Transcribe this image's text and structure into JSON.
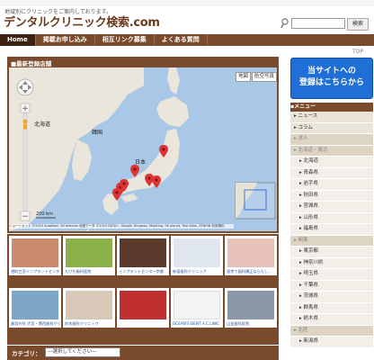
{
  "header": {
    "tagline": "地域別にクリニックをご案内しております。",
    "site_title": "デンタルクリニック検索.com",
    "search_button": "検索"
  },
  "nav": {
    "items": [
      {
        "label": "Home"
      },
      {
        "label": "掲載お申し込み"
      },
      {
        "label": "相互リンク募集"
      },
      {
        "label": "よくある質問"
      }
    ]
  },
  "top_link": "TOP",
  "map_panel": {
    "title": "■最新登録店舗",
    "map_type_map": "地図",
    "map_type_satellite": "航空写真",
    "labels": {
      "hokkaido": "北海道",
      "korea": "韓国",
      "japan": "日本"
    },
    "scale": "200 km",
    "attribution": "ショートカット ©2015 AutoNavi, SK telecom 地図データ ©2015 DATA+, Google, Kingway, MapKing, SK planet, Tele Atlas, ZENRIN 利用規約"
  },
  "thumbnails": [
    {
      "caption": "港町三宮インプラントセンター",
      "color": "#c88a6a"
    },
    {
      "caption": "たけち歯科医院",
      "color": "#8bb04a"
    },
    {
      "caption": "インプラントセンター京都",
      "color": "#5a3a2a"
    },
    {
      "caption": "新宿歯科クリニック",
      "color": "#dfe6ee"
    },
    {
      "caption": "東京で歯科矯正ならたし...",
      "color": "#e8c2b8"
    },
    {
      "caption": "美容外科 大宮・博西歯科クリニック",
      "color": "#7ea4c6"
    },
    {
      "caption": "鈴木歯科クリニック",
      "color": "#d8c8b8"
    },
    {
      "caption": "",
      "color": "#c03030"
    },
    {
      "caption": "OCEAN'S DENT A.C.LINIC",
      "color": "#f4f4f4"
    },
    {
      "caption": "山並歯科医院",
      "color": "#8c98a8"
    }
  ],
  "category": {
    "label": "カテゴリ：",
    "select_value": "—選択してください—"
  },
  "sidebar": {
    "banner_line1": "当サイトへの",
    "banner_line2": "登録はこちらから",
    "menu_title": "▪メニュー",
    "items": [
      {
        "label": "▸ ニュース",
        "type": "top"
      },
      {
        "label": "▸ コラム",
        "type": "top"
      },
      {
        "label": "▸ 求人",
        "type": "group"
      },
      {
        "label": "▸ 北海道・東北",
        "type": "group"
      },
      {
        "label": "▸ 北海道",
        "type": "sub"
      },
      {
        "label": "▸ 青森県",
        "type": "sub"
      },
      {
        "label": "▸ 岩手県",
        "type": "sub"
      },
      {
        "label": "▸ 秋田県",
        "type": "sub"
      },
      {
        "label": "▸ 宮城県",
        "type": "sub"
      },
      {
        "label": "▸ 山形県",
        "type": "sub"
      },
      {
        "label": "▸ 福島県",
        "type": "sub"
      },
      {
        "label": "▸ 関東",
        "type": "group"
      },
      {
        "label": "▸ 東京都",
        "type": "sub"
      },
      {
        "label": "▸ 神奈川県",
        "type": "sub"
      },
      {
        "label": "▸ 埼玉県",
        "type": "sub"
      },
      {
        "label": "▸ 千葉県",
        "type": "sub"
      },
      {
        "label": "▸ 茨城県",
        "type": "sub"
      },
      {
        "label": "▸ 群馬県",
        "type": "sub"
      },
      {
        "label": "▸ 栃木県",
        "type": "sub"
      },
      {
        "label": "▸ 北陸",
        "type": "group"
      },
      {
        "label": "▸ 新潟県",
        "type": "sub"
      }
    ]
  }
}
